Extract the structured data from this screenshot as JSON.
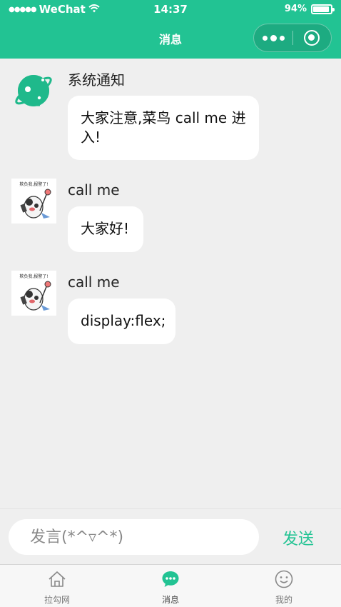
{
  "status_bar": {
    "signal": "●●●●●",
    "carrier": "WeChat",
    "time": "14:37",
    "battery": "94%",
    "battery_level": 0.94
  },
  "navbar": {
    "title": "消息",
    "accent_color": "#22c393"
  },
  "messages": [
    {
      "sender": "系统通知",
      "text": "大家注意,菜鸟 call me 进入!",
      "avatar_icon": "planet-icon"
    },
    {
      "sender": "call me",
      "text": "大家好!",
      "avatar_icon": "panda-sticker-avatar",
      "avatar_caption": "欺负我,报警了!"
    },
    {
      "sender": "call me",
      "text": "display:flex;",
      "avatar_icon": "panda-sticker-avatar",
      "avatar_caption": "欺负我,报警了!"
    }
  ],
  "composer": {
    "placeholder": "发言(*^▿^*)",
    "send_label": "发送"
  },
  "tabbar": {
    "items": [
      {
        "label": "拉勾网",
        "icon": "home-icon",
        "active": false
      },
      {
        "label": "消息",
        "icon": "chat-bubble-icon",
        "active": true
      },
      {
        "label": "我的",
        "icon": "smiley-icon",
        "active": false
      }
    ]
  }
}
